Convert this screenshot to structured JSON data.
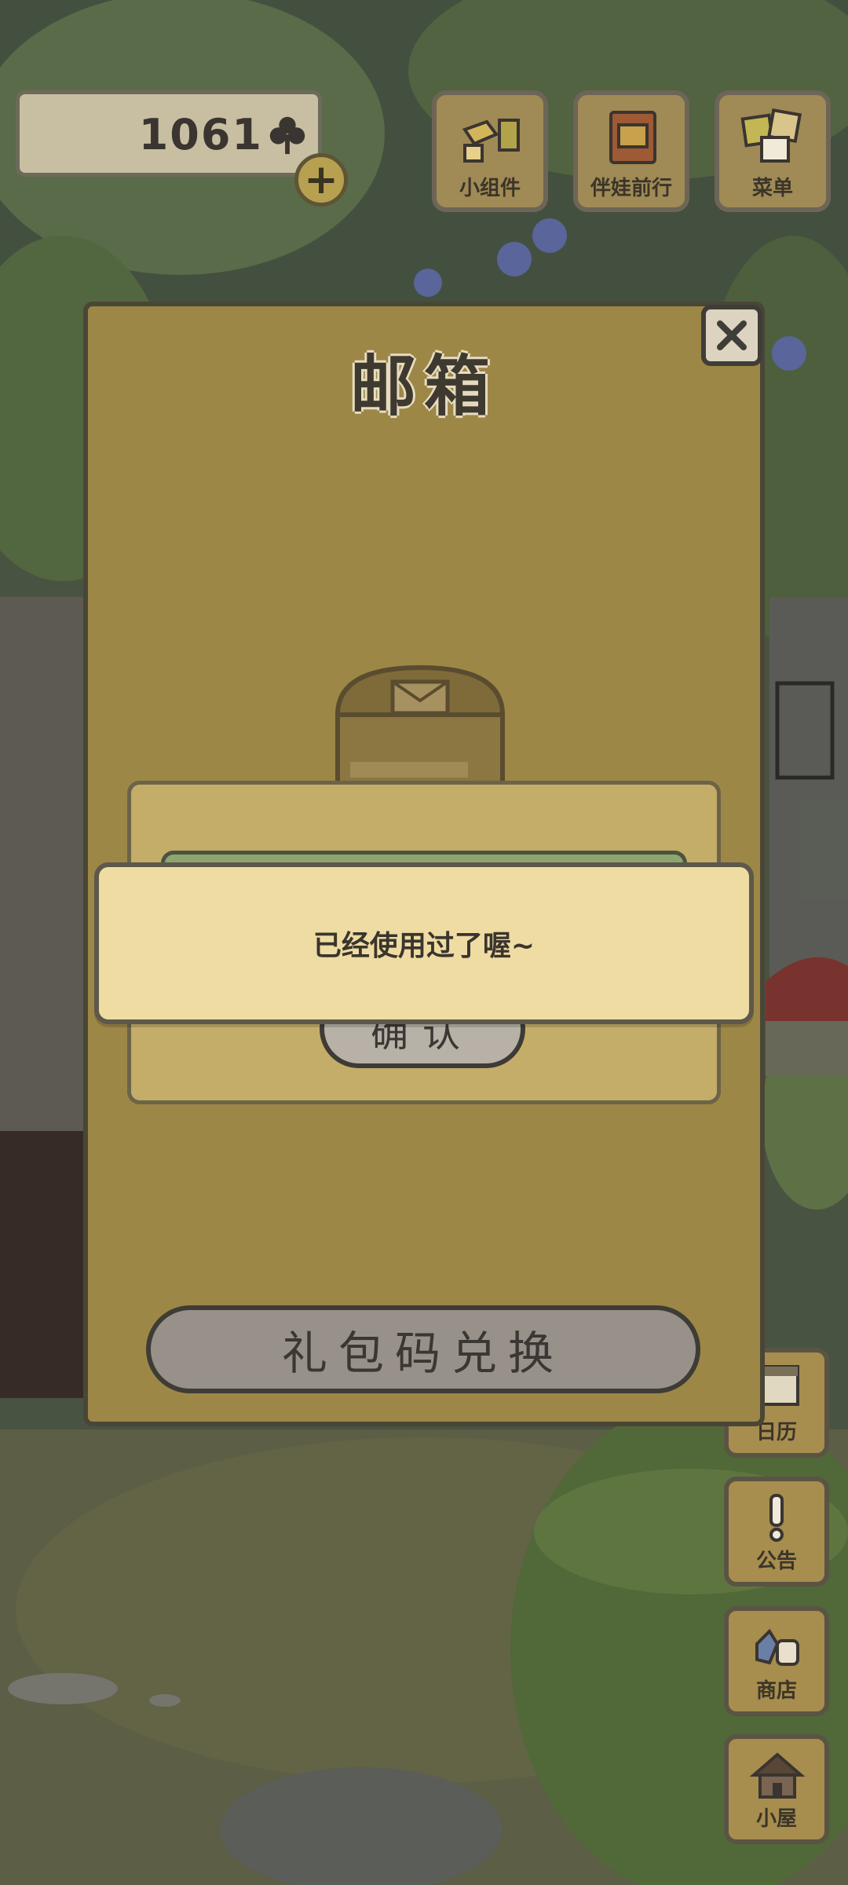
{
  "hud": {
    "clover_count": "1061",
    "buttons": [
      {
        "label": "小组件",
        "icon": "widget-icon"
      },
      {
        "label": "伴娃前行",
        "icon": "album-icon"
      },
      {
        "label": "菜单",
        "icon": "menu-icon"
      }
    ]
  },
  "side_buttons": [
    {
      "label": "日历",
      "icon": "calendar-icon"
    },
    {
      "label": "公告",
      "icon": "exclamation-icon"
    },
    {
      "label": "商店",
      "icon": "shop-icon"
    },
    {
      "label": "小屋",
      "icon": "house-icon"
    }
  ],
  "mailbox": {
    "title": "邮箱",
    "redeem_label": "礼包码兑换"
  },
  "inner_dialog": {
    "confirm_label": "确认"
  },
  "toast": {
    "message": "已经使用过了喔~"
  },
  "colors": {
    "dialog_bg": "#9d8747",
    "toast_bg": "#efdca3",
    "outline": "#4a4637"
  }
}
